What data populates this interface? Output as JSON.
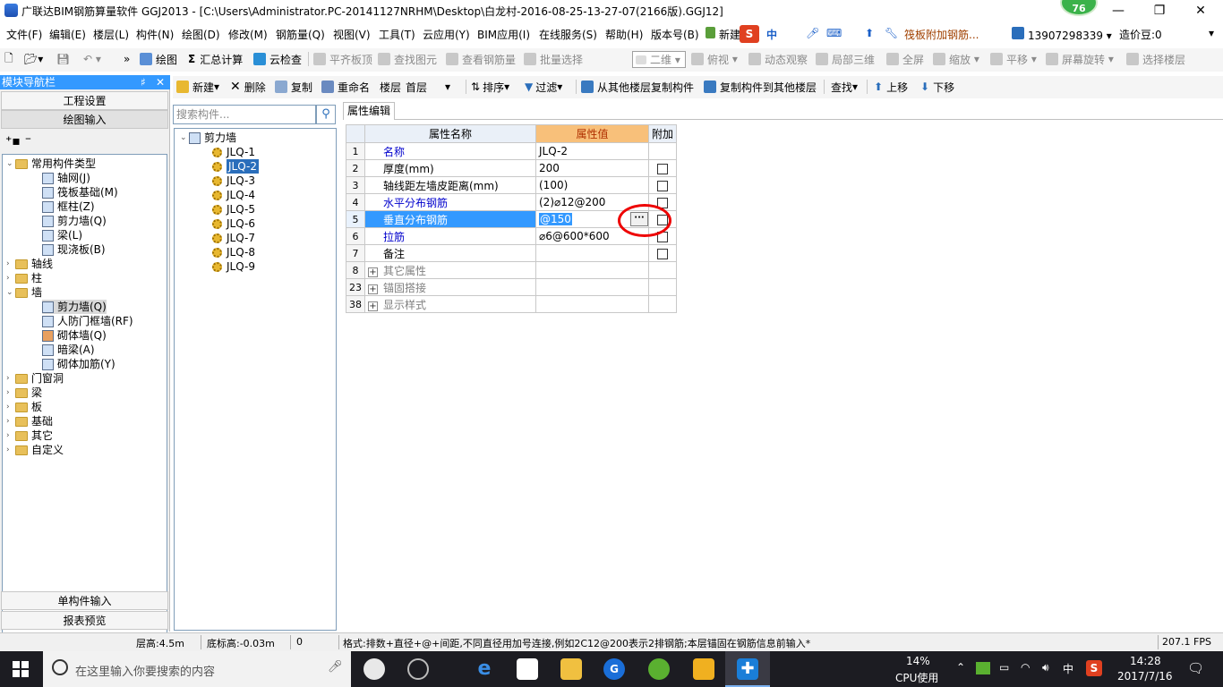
{
  "window": {
    "title": "广联达BIM钢筋算量软件 GGJ2013 - [C:\\Users\\Administrator.PC-20141127NRHM\\Desktop\\白龙村-2016-08-25-13-27-07(2166版).GGJ12]",
    "badge": "76",
    "minimize": "—",
    "restore": "❐",
    "close": "✕"
  },
  "menu": {
    "items": [
      "文件(F)",
      "编辑(E)",
      "楼层(L)",
      "构件(N)",
      "绘图(D)",
      "修改(M)",
      "钢筋量(Q)",
      "视图(V)",
      "工具(T)",
      "云应用(Y)",
      "BIM应用(I)",
      "在线服务(S)",
      "帮助(H)",
      "版本号(B)"
    ],
    "new_item": "新建",
    "notice": "筏板附加钢筋...",
    "phone": "13907298339",
    "coins": "造价豆:0",
    "ime_text": "中"
  },
  "toolbar1": {
    "draw": "绘图",
    "sum": "汇总计算",
    "cloud_check": "云检查",
    "flat_top": "平齐板顶",
    "find_elem": "查找图元",
    "view_rebar": "查看钢筋量",
    "batch_select": "批量选择",
    "view_mode": "二维",
    "top_view": "俯视",
    "dynamic": "动态观察",
    "local3d": "局部三维",
    "fullscreen": "全屏",
    "zoom": "缩放",
    "pan": "平移",
    "rotate": "屏幕旋转",
    "select_floor": "选择楼层"
  },
  "toolbar2": {
    "new": "新建",
    "delete": "删除",
    "copy": "复制",
    "rename": "重命名",
    "floor_label": "楼层",
    "floor_value": "首层",
    "sort": "排序",
    "filter": "过滤",
    "copy_from": "从其他楼层复制构件",
    "copy_to": "复制构件到其他楼层",
    "find": "查找",
    "up": "上移",
    "down": "下移"
  },
  "nav": {
    "header": "模块导航栏",
    "pin": "♯",
    "close": "✕",
    "project_settings": "工程设置",
    "draw_input": "绘图输入",
    "single_input": "单构件输入",
    "report_preview": "报表预览",
    "tree": [
      {
        "label": "常用构件类型",
        "kind": "folder",
        "caret": "⌄"
      },
      {
        "label": "轴网(J)",
        "kind": "child"
      },
      {
        "label": "筏板基础(M)",
        "kind": "child"
      },
      {
        "label": "框柱(Z)",
        "kind": "child"
      },
      {
        "label": "剪力墙(Q)",
        "kind": "child"
      },
      {
        "label": "梁(L)",
        "kind": "child"
      },
      {
        "label": "现浇板(B)",
        "kind": "child"
      },
      {
        "label": "轴线",
        "kind": "folder",
        "caret": "›"
      },
      {
        "label": "柱",
        "kind": "folder",
        "caret": "›"
      },
      {
        "label": "墙",
        "kind": "folder",
        "caret": "⌄"
      },
      {
        "label": "剪力墙(Q)",
        "kind": "child",
        "selected": true
      },
      {
        "label": "人防门框墙(RF)",
        "kind": "child"
      },
      {
        "label": "砌体墙(Q)",
        "kind": "child"
      },
      {
        "label": "暗梁(A)",
        "kind": "child"
      },
      {
        "label": "砌体加筋(Y)",
        "kind": "child"
      },
      {
        "label": "门窗洞",
        "kind": "folder",
        "caret": "›"
      },
      {
        "label": "梁",
        "kind": "folder",
        "caret": "›"
      },
      {
        "label": "板",
        "kind": "folder",
        "caret": "›"
      },
      {
        "label": "基础",
        "kind": "folder",
        "caret": "›"
      },
      {
        "label": "其它",
        "kind": "folder",
        "caret": "›"
      },
      {
        "label": "自定义",
        "kind": "folder",
        "caret": "›"
      }
    ]
  },
  "components": {
    "search_placeholder": "搜索构件...",
    "root": "剪力墙",
    "items": [
      "JLQ-1",
      "JLQ-2",
      "JLQ-3",
      "JLQ-4",
      "JLQ-5",
      "JLQ-6",
      "JLQ-7",
      "JLQ-8",
      "JLQ-9"
    ],
    "selected_index": 1
  },
  "properties": {
    "tab": "属性编辑",
    "col_name": "属性名称",
    "col_value": "属性值",
    "col_extra": "附加",
    "rows": [
      {
        "num": "1",
        "name": "名称",
        "value": "JLQ-2",
        "blue": true,
        "checkbox": false
      },
      {
        "num": "2",
        "name": "厚度(mm)",
        "value": "200",
        "blue": false,
        "checkbox": true
      },
      {
        "num": "3",
        "name": "轴线距左墙皮距离(mm)",
        "value": "(100)",
        "blue": false,
        "checkbox": true
      },
      {
        "num": "4",
        "name": "水平分布钢筋",
        "value": "(2)⌀12@200",
        "blue": true,
        "checkbox": true
      },
      {
        "num": "5",
        "name": "垂直分布钢筋",
        "value": "@150",
        "blue": true,
        "checkbox": true,
        "selected": true
      },
      {
        "num": "6",
        "name": "拉筋",
        "value": "⌀6@600*600",
        "blue": true,
        "checkbox": true
      },
      {
        "num": "7",
        "name": "备注",
        "value": "",
        "blue": false,
        "checkbox": true
      },
      {
        "num": "8",
        "name": "其它属性",
        "value": "",
        "group": true
      },
      {
        "num": "23",
        "name": "锚固搭接",
        "value": "",
        "group": true
      },
      {
        "num": "38",
        "name": "显示样式",
        "value": "",
        "group": true
      }
    ],
    "ellipsis": "···"
  },
  "status": {
    "floor_height": "层高:4.5m",
    "base_height": "底标高:-0.03m",
    "zero": "0",
    "hint": "格式:排数+直径+@+间距,不同直径用加号连接,例如2C12@200表示2排钢筋;本层锚固在钢筋信息前输入*",
    "fps": "207.1 FPS"
  },
  "taskbar": {
    "search_placeholder": "在这里输入你要搜索的内容",
    "cpu_percent": "14%",
    "cpu_label": "CPU使用",
    "ime": "中",
    "time": "14:28",
    "date": "2017/7/16"
  }
}
